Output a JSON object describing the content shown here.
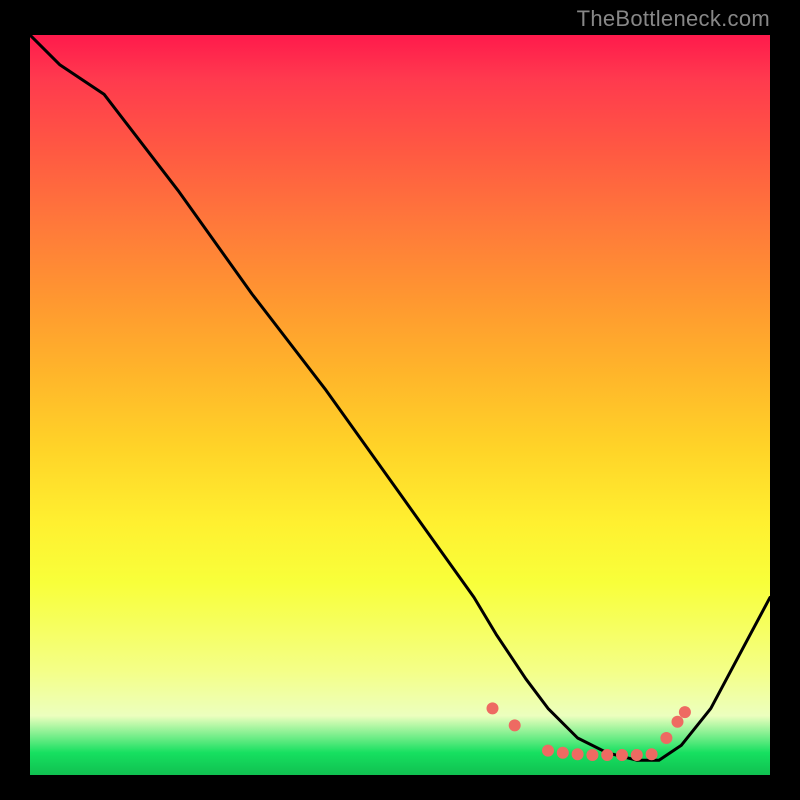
{
  "watermark": "TheBottleneck.com",
  "chart_data": {
    "type": "line",
    "title": "",
    "xlabel": "",
    "ylabel": "",
    "xlim": [
      0,
      100
    ],
    "ylim": [
      0,
      100
    ],
    "grid": false,
    "series": [
      {
        "name": "curve",
        "color": "#000000",
        "x": [
          0,
          4,
          10,
          20,
          30,
          40,
          50,
          55,
          60,
          63,
          67,
          70,
          74,
          78,
          82,
          85,
          88,
          92,
          100
        ],
        "y": [
          100,
          96,
          92,
          79,
          65,
          52,
          38,
          31,
          24,
          19,
          13,
          9,
          5,
          3,
          2,
          2,
          4,
          9,
          24
        ]
      }
    ],
    "markers": {
      "name": "dots",
      "color": "#ee6a62",
      "radius_px": 6,
      "x": [
        62.5,
        65.5,
        70,
        72,
        74,
        76,
        78,
        80,
        82,
        84,
        86,
        87.5,
        88.5
      ],
      "y": [
        9.0,
        6.7,
        3.3,
        3.0,
        2.8,
        2.7,
        2.7,
        2.7,
        2.7,
        2.8,
        5.0,
        7.2,
        8.5
      ]
    }
  }
}
